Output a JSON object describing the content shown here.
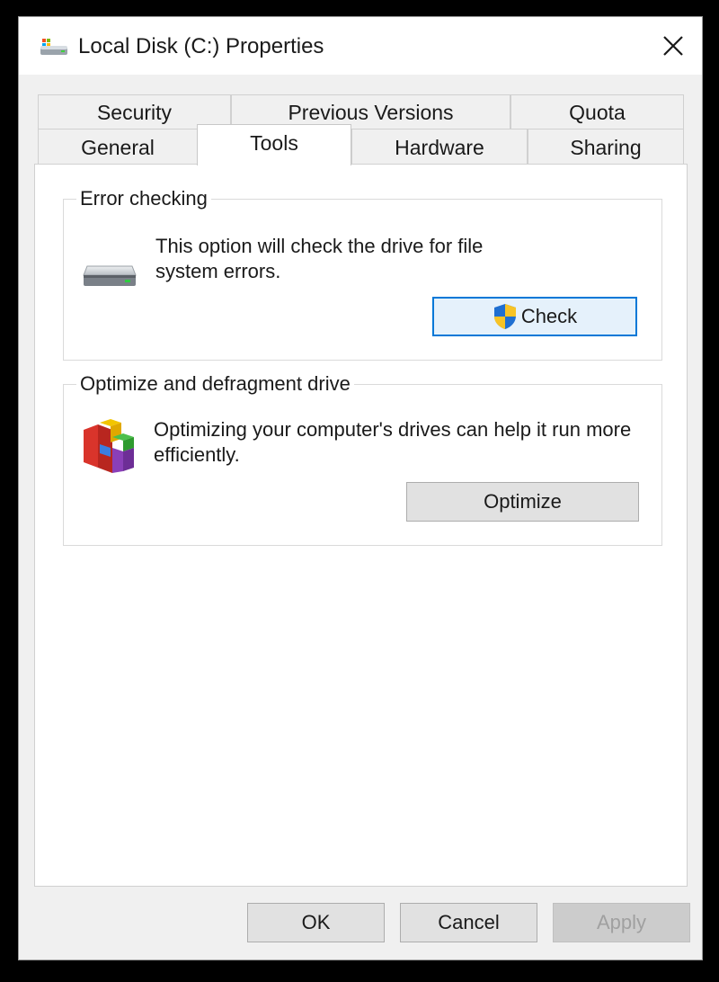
{
  "window": {
    "title": "Local Disk (C:) Properties",
    "close_glyph": "✕"
  },
  "tabs": {
    "back_row": [
      {
        "label": "Security"
      },
      {
        "label": "Previous Versions"
      },
      {
        "label": "Quota"
      }
    ],
    "front_row": [
      {
        "label": "General"
      },
      {
        "label": "Tools",
        "active": true
      },
      {
        "label": "Hardware"
      },
      {
        "label": "Sharing"
      }
    ]
  },
  "error_checking": {
    "title": "Error checking",
    "description": "This option will check the drive for file system errors.",
    "button_label": "Check",
    "icon": "drive-icon"
  },
  "optimize": {
    "title": "Optimize and defragment drive",
    "description": "Optimizing your computer's drives can help it run more efficiently.",
    "button_label": "Optimize",
    "icon": "defrag-icon"
  },
  "footer": {
    "ok_label": "OK",
    "cancel_label": "Cancel",
    "apply_label": "Apply"
  },
  "colors": {
    "accent": "#0078d7",
    "shield_blue": "#1f6fd1",
    "shield_yellow": "#f7c325"
  }
}
